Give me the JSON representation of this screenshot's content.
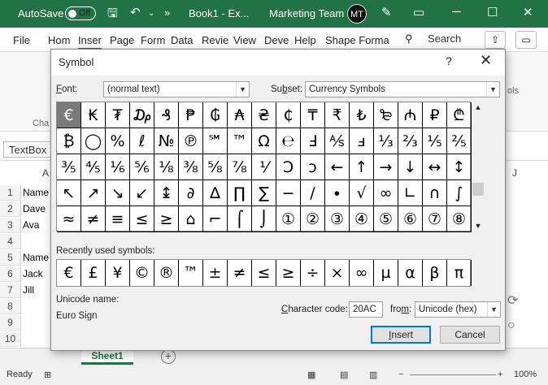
{
  "titlebar": {
    "autosave_label": "AutoSave",
    "autosave_state": "Off",
    "doc_title": "Book1 - Ex...",
    "team_name": "Marketing Team",
    "avatar_initials": "MT",
    "overflow": "»"
  },
  "tabs": [
    "File",
    "Hom",
    "Inser",
    "Page",
    "Form",
    "Data",
    "Revie",
    "View",
    "Deve",
    "Help",
    "Shape Forma"
  ],
  "search_label": "Search",
  "background": {
    "namebox_value": "TextBox",
    "ribbon_fragment": "Cha",
    "ribbon_fragment2": "ols",
    "column_A": "A",
    "column_J": "J",
    "rows": [
      {
        "num": "1",
        "text": "Name"
      },
      {
        "num": "2",
        "text": "Dave"
      },
      {
        "num": "3",
        "text": "Ava"
      },
      {
        "num": "4",
        "text": ""
      },
      {
        "num": "5",
        "text": "Name"
      },
      {
        "num": "6",
        "text": "Jack"
      },
      {
        "num": "7",
        "text": "Jill"
      },
      {
        "num": "8",
        "text": ""
      },
      {
        "num": "9",
        "text": ""
      },
      {
        "num": "10",
        "text": ""
      }
    ],
    "sheet_tab": "Sheet1",
    "add_sheet": "+",
    "status_ready": "Ready",
    "zoom": "100%"
  },
  "dialog": {
    "title": "Symbol",
    "help": "?",
    "font_label_u": "F",
    "font_label_rest": "ont:",
    "font_value": "(normal text)",
    "subset_label_pre": "Su",
    "subset_label_u": "b",
    "subset_label_rest": "set:",
    "subset_value": "Currency Symbols",
    "symbols": [
      "€",
      "₭",
      "₮",
      "₯",
      "₰",
      "₱",
      "₲",
      "₳",
      "₴",
      "₵",
      "₸",
      "₹",
      "₺",
      "₻",
      "₼",
      "₽",
      "₾",
      "₿",
      "◯",
      "%",
      "ℓ",
      "№",
      "℗",
      "℠",
      "™",
      "Ω",
      "℮",
      "Ⅎ",
      "⅍",
      "ⅎ",
      "⅓",
      "⅔",
      "⅕",
      "⅖",
      "⅗",
      "⅘",
      "⅙",
      "⅚",
      "⅛",
      "⅜",
      "⅝",
      "⅞",
      "⅟",
      "Ↄ",
      "ↄ",
      "←",
      "↑",
      "→",
      "↓",
      "↔",
      "↕",
      "↖",
      "↗",
      "↘",
      "↙",
      "↨",
      "∂",
      "∆",
      "∏",
      "∑",
      "−",
      "∕",
      "∙",
      "√",
      "∞",
      "∟",
      "∩",
      "∫",
      "≈",
      "≠",
      "≡",
      "≤",
      "≥",
      "⌂",
      "⌐",
      "⌠",
      "⌡",
      "①",
      "②",
      "③",
      "④",
      "⑤",
      "⑥",
      "⑦",
      "⑧"
    ],
    "selected_index": 0,
    "recent_label": "Recently used symbols:",
    "recent": [
      "€",
      "£",
      "¥",
      "©",
      "®",
      "™",
      "±",
      "≠",
      "≤",
      "≥",
      "÷",
      "×",
      "∞",
      "µ",
      "α",
      "β",
      "π"
    ],
    "unicode_name_label": "Unicode name:",
    "unicode_name_value": "Euro Sign",
    "charcode_label_pre": "",
    "charcode_label_u": "C",
    "charcode_label_rest": "haracter code:",
    "charcode_value": "20AC",
    "from_label_pre": "fro",
    "from_label_u": "m",
    "from_label_rest": ":",
    "from_value": "Unicode (hex)",
    "insert_label_pre": "",
    "insert_label_u": "I",
    "insert_label_rest": "nsert",
    "cancel_label": "Cancel"
  }
}
